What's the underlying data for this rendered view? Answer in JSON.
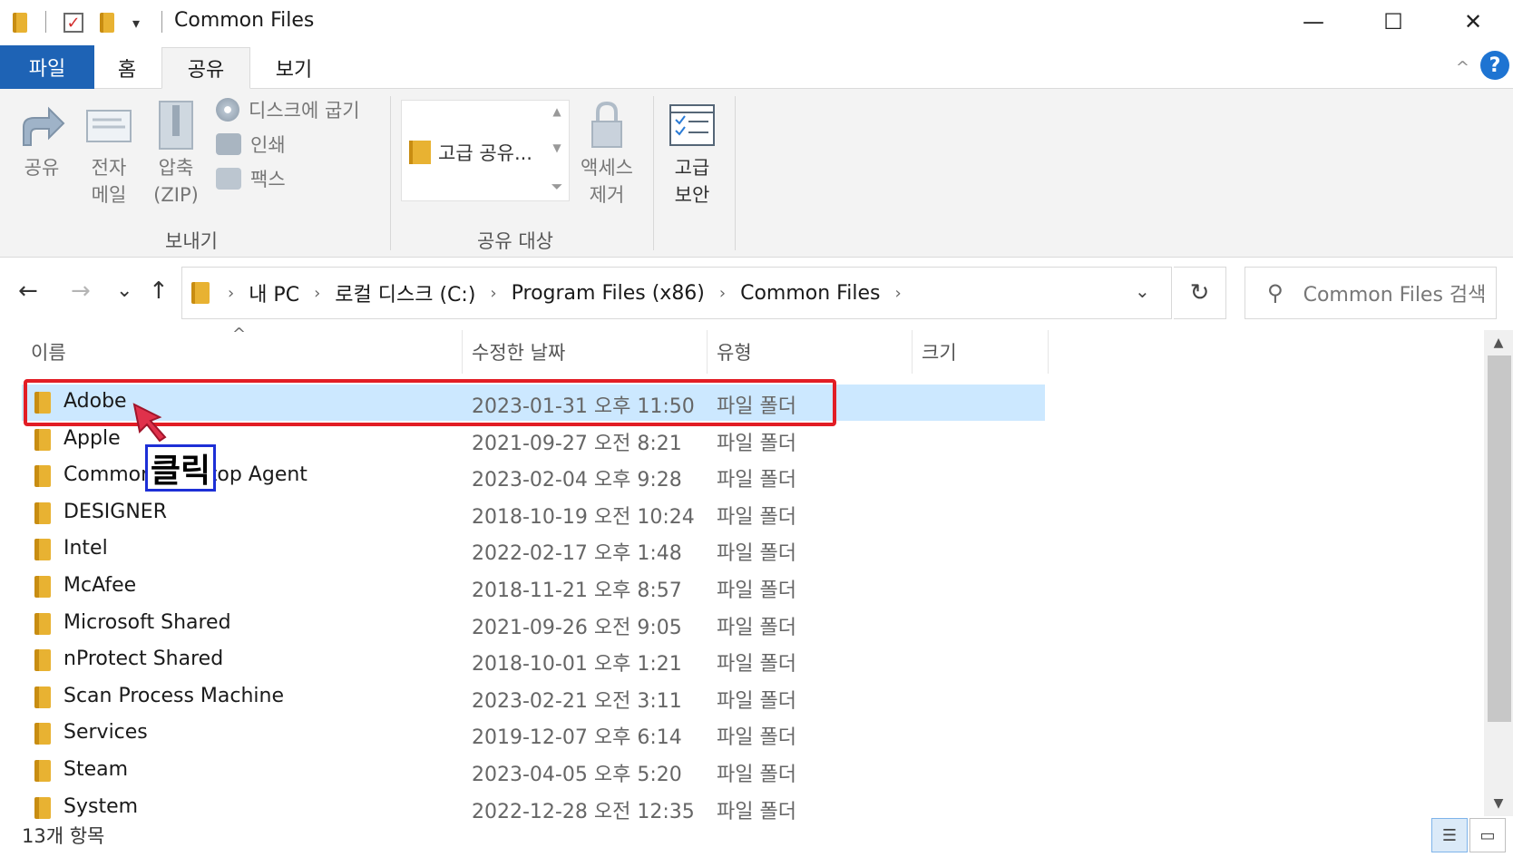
{
  "window": {
    "title": "Common Files",
    "minimize": "—",
    "maximize": "☐",
    "close": "✕"
  },
  "tabs": {
    "file": "파일",
    "home": "홈",
    "share": "공유",
    "view": "보기",
    "collapse": "^",
    "help": "?"
  },
  "ribbon": {
    "share": "공유",
    "email_1": "전자",
    "email_2": "메일",
    "zip_1": "압축",
    "zip_2": "(ZIP)",
    "burn": "디스크에 굽기",
    "print": "인쇄",
    "fax": "팩스",
    "send_group": "보내기",
    "advanced_share": "고급 공유...",
    "share_with_group": "공유 대상",
    "remove_access_1": "액세스",
    "remove_access_2": "제거",
    "advanced_security_1": "고급",
    "advanced_security_2": "보안"
  },
  "nav": {
    "back": "←",
    "forward": "→",
    "recent": "⌄",
    "up": "↑",
    "breadcrumb": [
      "내 PC",
      "로컬 디스크 (C:)",
      "Program Files (x86)",
      "Common Files"
    ],
    "refresh": "↻",
    "search_placeholder": "Common Files 검색"
  },
  "columns": {
    "name": "이름",
    "date": "수정한 날짜",
    "type": "유형",
    "size": "크기",
    "sort": "^"
  },
  "files": [
    {
      "name": "Adobe",
      "date": "2023-01-31 오후 11:50",
      "type": "파일 폴더"
    },
    {
      "name": "Apple",
      "date": "2021-09-27 오전 8:21",
      "type": "파일 폴더"
    },
    {
      "name": "Common Desktop Agent",
      "date": "2023-02-04 오후 9:28",
      "type": "파일 폴더"
    },
    {
      "name": "DESIGNER",
      "date": "2018-10-19 오전 10:24",
      "type": "파일 폴더"
    },
    {
      "name": "Intel",
      "date": "2022-02-17 오후 1:48",
      "type": "파일 폴더"
    },
    {
      "name": "McAfee",
      "date": "2018-11-21 오후 8:57",
      "type": "파일 폴더"
    },
    {
      "name": "Microsoft Shared",
      "date": "2021-09-26 오전 9:05",
      "type": "파일 폴더"
    },
    {
      "name": "nProtect Shared",
      "date": "2018-10-01 오후 1:21",
      "type": "파일 폴더"
    },
    {
      "name": "Scan Process Machine",
      "date": "2023-02-21 오전 3:11",
      "type": "파일 폴더"
    },
    {
      "name": "Services",
      "date": "2019-12-07 오후 6:14",
      "type": "파일 폴더"
    },
    {
      "name": "Steam",
      "date": "2023-04-05 오후 5:20",
      "type": "파일 폴더"
    },
    {
      "name": "System",
      "date": "2022-12-28 오전 12:35",
      "type": "파일 폴더"
    }
  ],
  "selected_index": 0,
  "annotation": {
    "label": "클릭"
  },
  "status": {
    "count": "13개 항목"
  },
  "colors": {
    "file_tab": "#1e63b5",
    "selection": "#cce8ff",
    "highlight_box": "#e21d25",
    "label_box": "#1d2fd6",
    "folder": "#e8b232"
  }
}
